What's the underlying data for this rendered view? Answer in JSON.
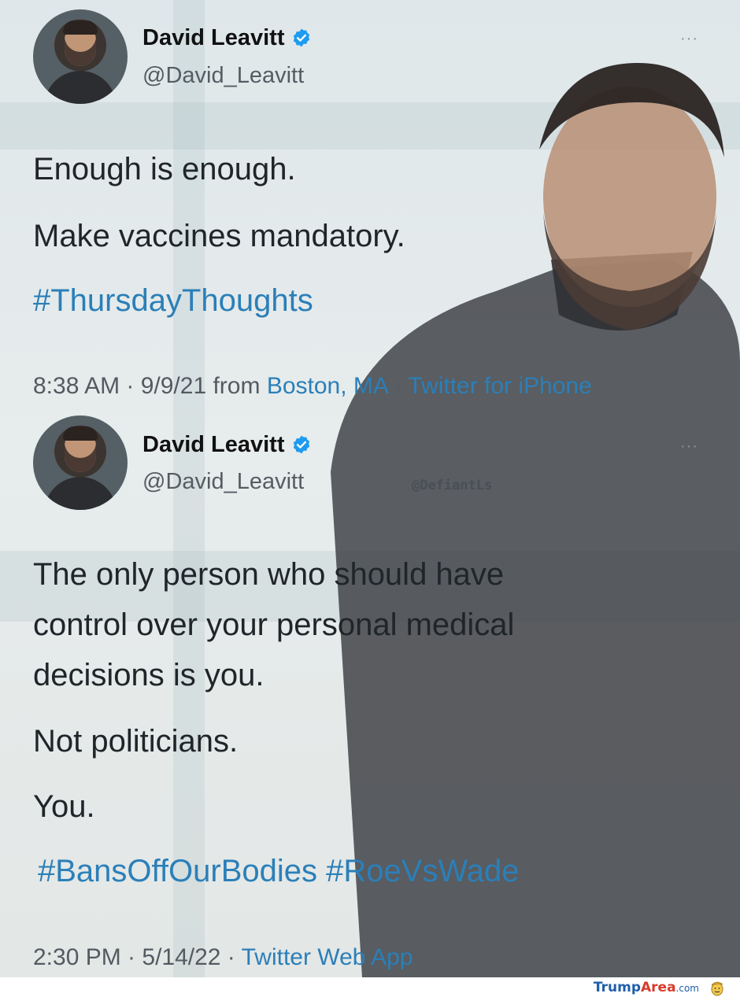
{
  "tweet1": {
    "name": "David Leavitt",
    "handle": "@David_Leavitt",
    "more": "···",
    "lines": [
      "Enough is enough.",
      "Make vaccines mandatory."
    ],
    "hashtag": "#ThursdayThoughts",
    "meta": {
      "time": "8:38 AM · 9/9/21 from ",
      "location": "Boston, MA",
      "sep": " · ",
      "source": "Twitter for iPhone"
    }
  },
  "tweet2": {
    "name": "David Leavitt",
    "handle": "@David_Leavitt",
    "more": "···",
    "lines": [
      "The only person who should have",
      "control over your personal medical",
      "decisions is you.",
      "Not politicians.",
      "You."
    ],
    "hashtags": "#BansOffOurBodies #RoeVsWade",
    "meta": {
      "time": "2:30 PM · 5/14/22 · ",
      "source": "Twitter Web App"
    }
  },
  "watermark": "@DefiantLs",
  "footer": {
    "brand_part1": "Trump",
    "brand_part2": "Area",
    "brand_suffix": ".com"
  },
  "colors": {
    "link": "#2b7fb8",
    "verified": "#1d9bf0",
    "text": "#20252a",
    "meta": "#535b61"
  },
  "icons": {
    "verified": "verified-badge-icon",
    "more": "more-options-icon",
    "brand": "trump-face-icon"
  }
}
